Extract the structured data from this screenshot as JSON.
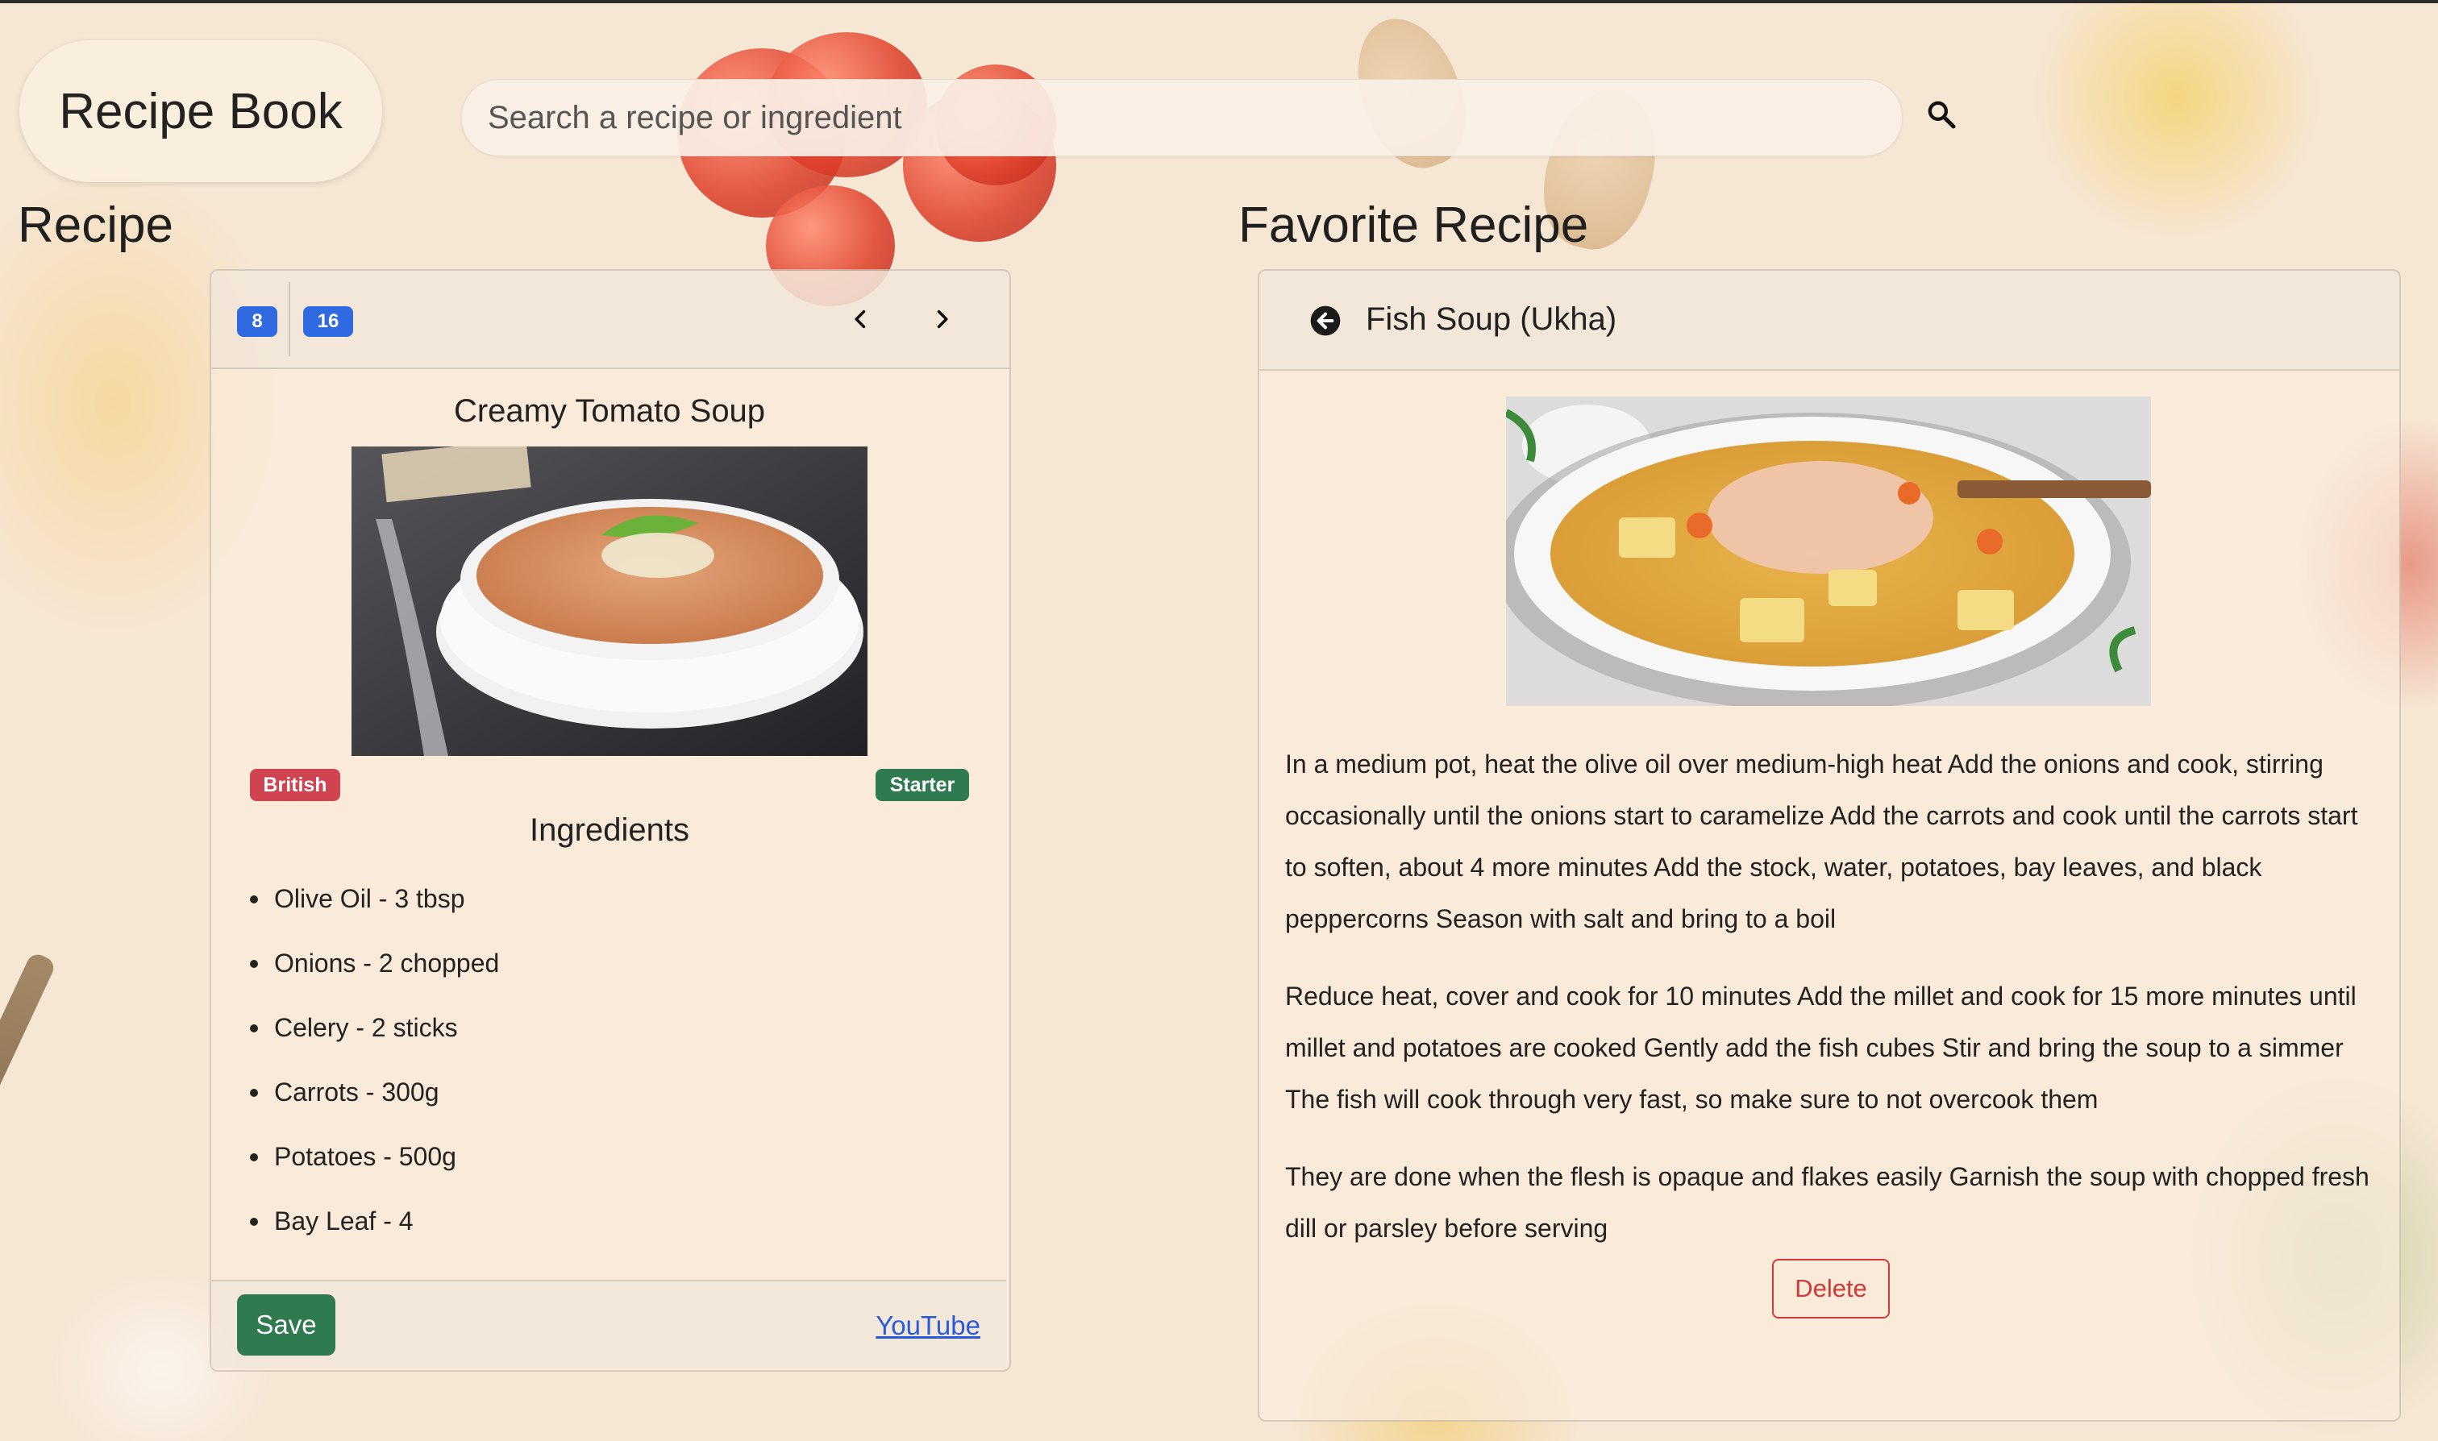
{
  "app": {
    "brand": "Recipe Book"
  },
  "search": {
    "placeholder": "Search a recipe or ingredient",
    "value": ""
  },
  "recipe_section": {
    "heading": "Recipe",
    "badges": [
      "8",
      "16"
    ],
    "recipe": {
      "title": "Creamy Tomato Soup",
      "area_tag": "British",
      "category_tag": "Starter",
      "ingredients_heading": "Ingredients",
      "ingredients": [
        "Olive Oil - 3 tbsp",
        "Onions - 2 chopped",
        "Celery - 2 sticks",
        "Carrots - 300g",
        "Potatoes - 500g",
        "Bay Leaf - 4"
      ]
    },
    "save_label": "Save",
    "youtube_label": "YouTube"
  },
  "favorite_section": {
    "heading": "Favorite Recipe",
    "recipe_title": "Fish Soup (Ukha)",
    "instructions": [
      "In a medium pot, heat the olive oil over medium-high heat Add the onions and cook, stirring occasionally until the onions start to caramelize Add the carrots and cook until the carrots start to soften, about 4 more minutes Add the stock, water, potatoes, bay leaves, and black peppercorns Season with salt and bring to a boil",
      "Reduce heat, cover and cook for 10 minutes Add the millet and cook for 15 more minutes until millet and potatoes are cooked Gently add the fish cubes Stir and bring the soup to a simmer The fish will cook through very fast, so make sure to not overcook them",
      "They are done when the flesh is opaque and flakes easily Garnish the soup with chopped fresh dill or parsley before serving"
    ],
    "delete_label": "Delete"
  },
  "colors": {
    "badge_blue": "#2f6ae0",
    "tag_british": "#d04452",
    "tag_starter": "#2f7a4f",
    "save_green": "#2f7a4f",
    "delete_red": "#d23a3a",
    "link_blue": "#2a5bd7"
  },
  "icons": {
    "search": "search-icon",
    "prev": "chevron-left-icon",
    "next": "chevron-right-icon",
    "back": "arrow-left-circle-icon"
  }
}
